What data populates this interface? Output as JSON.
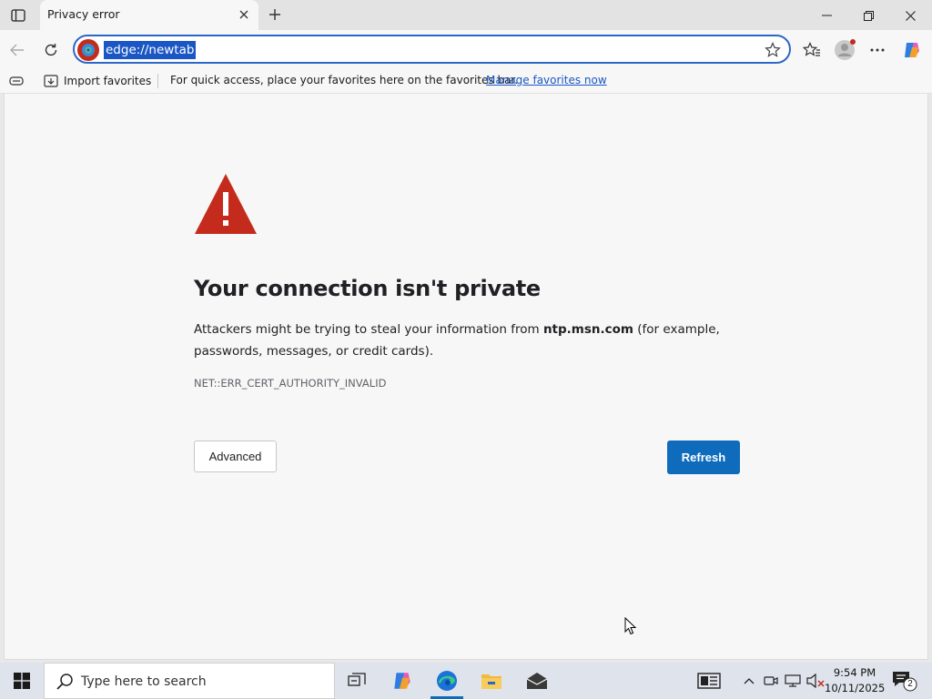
{
  "tab": {
    "title": "Privacy error"
  },
  "omnibox": {
    "url": "edge://newtab"
  },
  "favorites_bar": {
    "import_label": "Import favorites",
    "message": "For quick access, place your favorites here on the favorites bar.",
    "link": "Manage favorites now"
  },
  "error_page": {
    "headline": "Your connection isn't private",
    "description_before": "Attackers might be trying to steal your information from ",
    "host": "ntp.msn.com",
    "description_after": " (for example, passwords, messages, or credit cards).",
    "error_code": "NET::ERR_CERT_AUTHORITY_INVALID",
    "advanced_label": "Advanced",
    "refresh_label": "Refresh"
  },
  "taskbar": {
    "search_placeholder": "Type here to search",
    "time": "9:54 PM",
    "date": "10/11/2025",
    "notification_count": "2"
  },
  "colors": {
    "accent": "#0f6cbd",
    "warning": "#c42b1c",
    "selection": "#1a57c4"
  }
}
